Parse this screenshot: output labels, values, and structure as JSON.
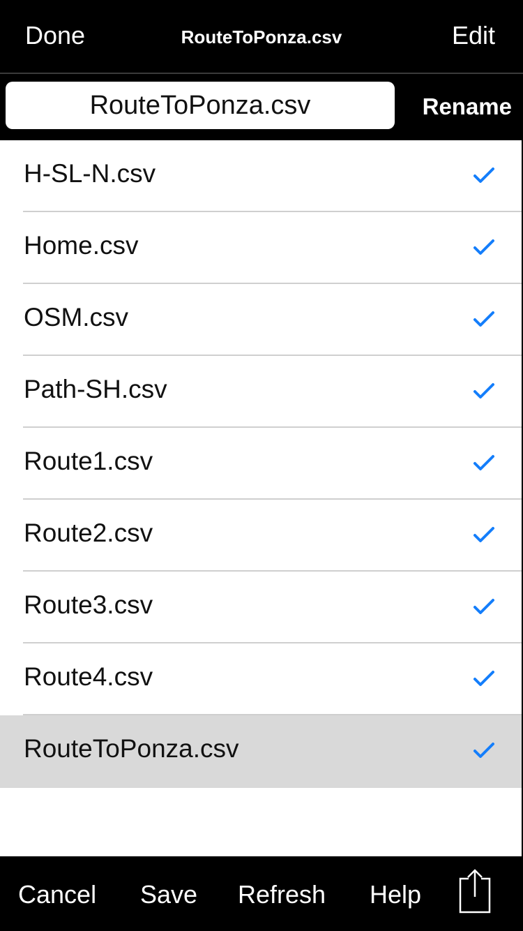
{
  "navbar": {
    "left_button": "Done",
    "title": "RouteToPonza.csv",
    "right_button": "Edit"
  },
  "rename_bar": {
    "field_value": "RouteToPonza.csv",
    "button_label": "Rename"
  },
  "files": [
    {
      "name": "H-SL-N.csv",
      "checked": true,
      "selected": false
    },
    {
      "name": "Home.csv",
      "checked": true,
      "selected": false
    },
    {
      "name": "OSM.csv",
      "checked": true,
      "selected": false
    },
    {
      "name": "Path-SH.csv",
      "checked": true,
      "selected": false
    },
    {
      "name": "Route1.csv",
      "checked": true,
      "selected": false
    },
    {
      "name": "Route2.csv",
      "checked": true,
      "selected": false
    },
    {
      "name": "Route3.csv",
      "checked": true,
      "selected": false
    },
    {
      "name": "Route4.csv",
      "checked": true,
      "selected": false
    },
    {
      "name": "RouteToPonza.csv",
      "checked": true,
      "selected": true
    }
  ],
  "toolbar": {
    "cancel": "Cancel",
    "save": "Save",
    "refresh": "Refresh",
    "help": "Help",
    "share_icon": "share-icon"
  },
  "colors": {
    "accent": "#147efb",
    "bar_background": "#000000",
    "selected_row": "#d9d9d9"
  }
}
